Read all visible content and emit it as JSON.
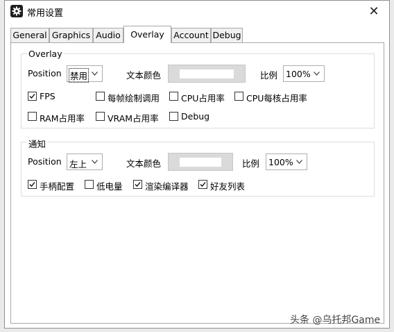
{
  "window": {
    "title": "常用设置",
    "close_glyph": "✕"
  },
  "tabs": [
    {
      "label": "General"
    },
    {
      "label": "Graphics"
    },
    {
      "label": "Audio"
    },
    {
      "label": "Overlay",
      "active": true
    },
    {
      "label": "Account"
    },
    {
      "label": "Debug"
    }
  ],
  "overlay": {
    "legend": "Overlay",
    "position_label": "Position",
    "position_value": "禁用",
    "text_color_label": "文本颜色",
    "text_color": "#ffffff",
    "scale_label": "比例",
    "scale_value": "100%",
    "checkboxes": [
      {
        "label": "FPS",
        "checked": true
      },
      {
        "label": "每帧绘制调用",
        "checked": false
      },
      {
        "label": "CPU占用率",
        "checked": false
      },
      {
        "label": "CPU每核占用率",
        "checked": false
      },
      {
        "label": "RAM占用率",
        "checked": false
      },
      {
        "label": "VRAM占用率",
        "checked": false
      },
      {
        "label": "Debug",
        "checked": false
      }
    ]
  },
  "notify": {
    "legend": "通知",
    "position_label": "Position",
    "position_value": "左上",
    "text_color_label": "文本颜色",
    "text_color": "#ffffff",
    "scale_label": "比例",
    "scale_value": "100%",
    "checkboxes": [
      {
        "label": "手柄配置",
        "checked": true
      },
      {
        "label": "低电量",
        "checked": false
      },
      {
        "label": "渲染编译器",
        "checked": true
      },
      {
        "label": "好友列表",
        "checked": true
      }
    ]
  },
  "watermark": "头条 @乌托邦Game"
}
